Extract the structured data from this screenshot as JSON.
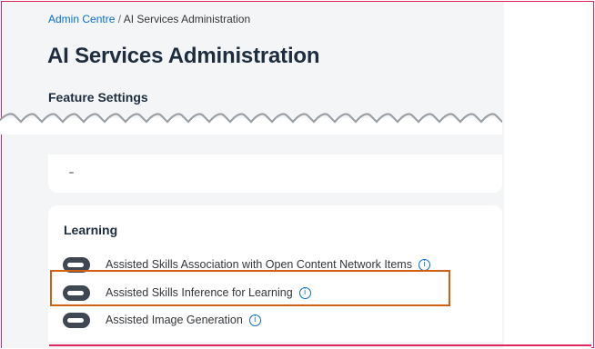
{
  "breadcrumb": {
    "parent": "Admin Centre",
    "separator": "/",
    "current": "AI Services Administration"
  },
  "page_title": "AI Services Administration",
  "feature_settings": {
    "heading": "Feature Settings"
  },
  "learning": {
    "heading": "Learning",
    "items": [
      {
        "label": "Assisted Skills Association with Open Content Network Items",
        "enabled": false,
        "info_icon": "info-icon"
      },
      {
        "label": "Assisted Skills Inference for Learning",
        "enabled": false,
        "info_icon": "info-icon",
        "highlighted": true
      },
      {
        "label": "Assisted Image Generation",
        "enabled": false,
        "info_icon": "info-icon"
      }
    ]
  },
  "colors": {
    "link": "#0a6ed1",
    "highlight_border": "#d35f12",
    "frame_border": "#e0245e",
    "toggle_off": "#3e4752"
  }
}
